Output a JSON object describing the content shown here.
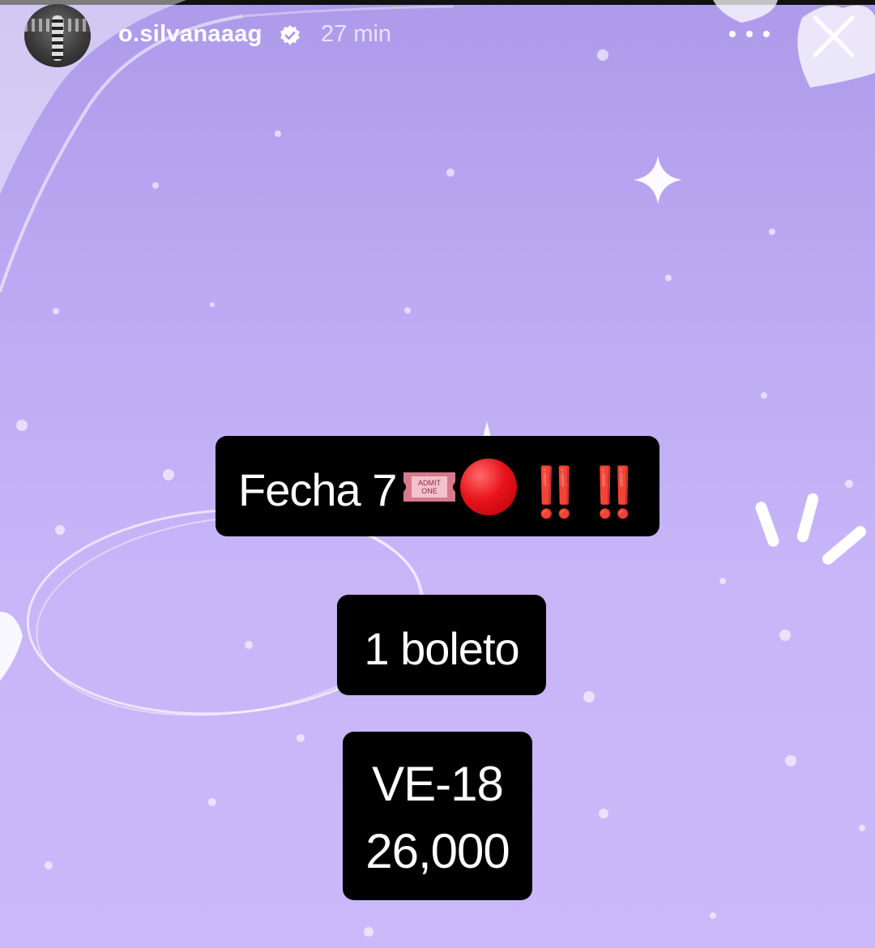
{
  "header": {
    "username": "o.silvanaaag",
    "time_ago": "27 min"
  },
  "stickers": {
    "line1_text": "Fecha 7",
    "ticket_line1": "ADMIT",
    "ticket_line2": "ONE",
    "exclamations": "‼️‼️",
    "line2_text": "1 boleto",
    "line3_text": "VE-18",
    "line4_text": "26,000"
  },
  "icons": {
    "verified": "verified-badge-icon",
    "more": "more-options-icon",
    "close": "close-icon",
    "ticket": "admission-ticket-icon",
    "red_circle": "red-circle-icon"
  },
  "colors": {
    "background_top": "#ad9bea",
    "background_bottom": "#cbb9fa",
    "sticker_bg": "#000000",
    "sticker_text": "#ffffff",
    "accent_red": "#e8141b"
  }
}
